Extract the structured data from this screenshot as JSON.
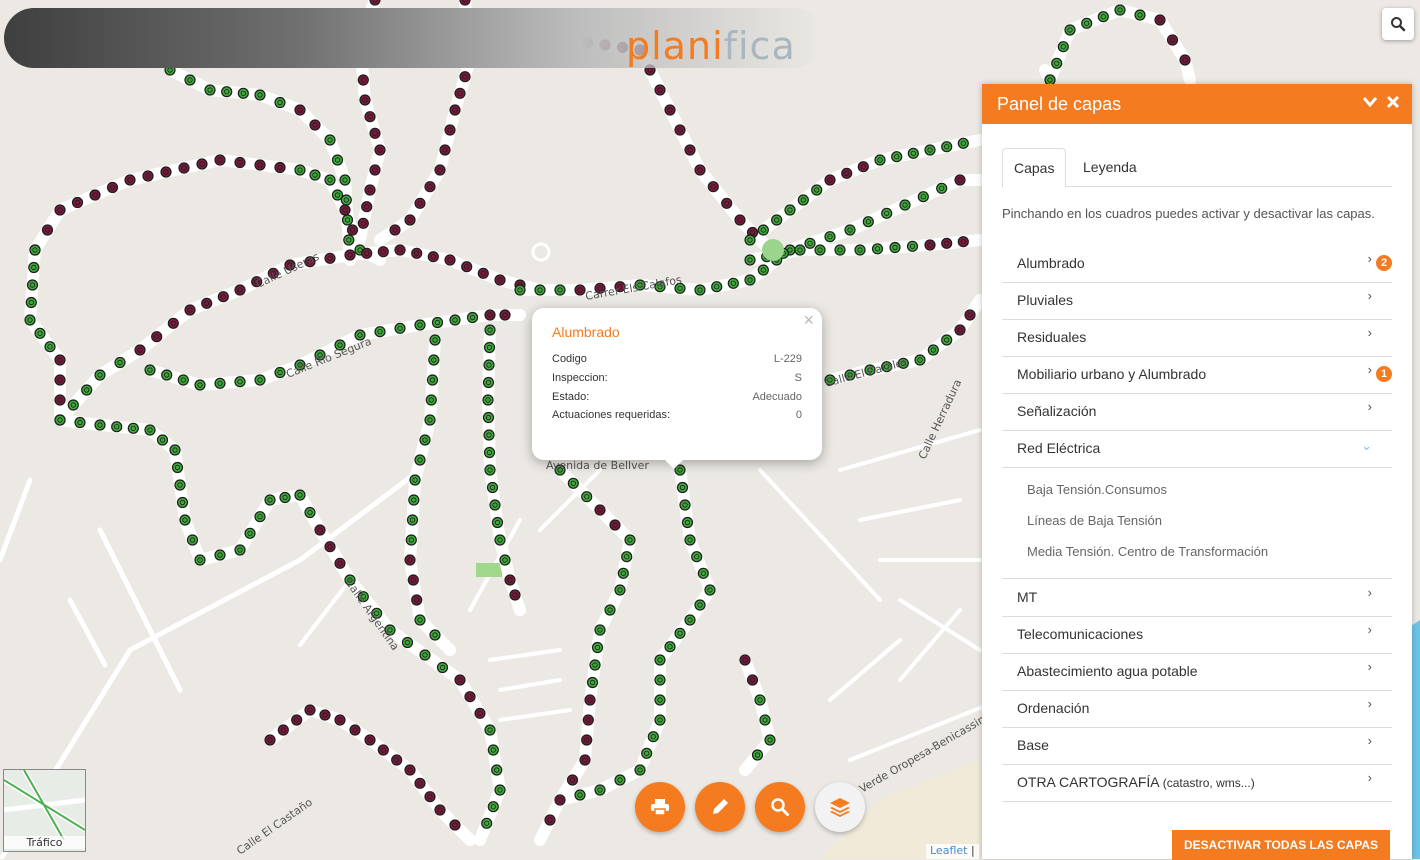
{
  "brand": {
    "pre": "plan",
    "accent": "i",
    "post": "fica"
  },
  "map": {
    "streets": [
      "Calle Useras",
      "Calle Río Segura",
      "Calle Argentina",
      "Avenida de Bellver",
      "Calle El Caralet",
      "Calle Herradura",
      "Carrer Els Calafos",
      "Verde Oropesa-Benicassim",
      "Calle El Castaño"
    ],
    "colors": {
      "working": "#3fa83a",
      "fault": "#7a1a3c",
      "accent": "#f47b20"
    }
  },
  "popup": {
    "title": "Alumbrado",
    "close": "×",
    "rows": [
      {
        "k": "Codigo",
        "v": "L-229"
      },
      {
        "k": "Inspeccion:",
        "v": "S"
      },
      {
        "k": "Estado:",
        "v": "Adecuado"
      },
      {
        "k": "Actuaciones requeridas:",
        "v": "0"
      }
    ]
  },
  "panel": {
    "title": "Panel de capas",
    "tabs": [
      "Capas",
      "Leyenda"
    ],
    "intro": "Pinchando en los cuadros puedes activar y desactivar las capas.",
    "layers": [
      {
        "label": "Alumbrado",
        "badge": "2"
      },
      {
        "label": "Pluviales"
      },
      {
        "label": "Residuales"
      },
      {
        "label": "Mobiliario urbano y Alumbrado",
        "badge": "1"
      },
      {
        "label": "Señalización"
      },
      {
        "label": "Red Eléctrica",
        "expanded": true
      }
    ],
    "sublayers": [
      "Baja Tensión.Consumos",
      "Líneas de Baja Tensión",
      "Media Tensión. Centro de Transformación"
    ],
    "layers2": [
      {
        "label": "MT"
      },
      {
        "label": "Telecomunicaciones"
      },
      {
        "label": "Abastecimiento agua potable"
      },
      {
        "label": "Ordenación"
      },
      {
        "label": "Base"
      },
      {
        "label": "OTRA CARTOGRAFÍA",
        "small": "(catastro, wms...)"
      }
    ],
    "deactivate": "DESACTIVAR TODAS LAS CAPAS"
  },
  "toolbar": {
    "print": "print-icon",
    "edit": "pencil-icon",
    "search": "search-icon",
    "layers": "layers-icon"
  },
  "traffic": {
    "label": "Tráfico"
  },
  "attribution": {
    "leaflet": "Leaflet",
    "sep": " | "
  }
}
